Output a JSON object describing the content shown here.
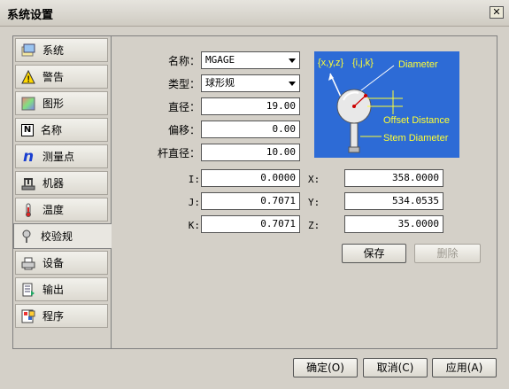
{
  "window": {
    "title": "系统设置",
    "close_glyph": "✕"
  },
  "sidebar": {
    "items": [
      {
        "label": "系统",
        "icon": "settings-icon"
      },
      {
        "label": "警告",
        "icon": "warning-icon"
      },
      {
        "label": "图形",
        "icon": "graphics-icon"
      },
      {
        "label": "名称",
        "icon": "name-icon",
        "glyph": "N"
      },
      {
        "label": "测量点",
        "icon": "measure-point-icon",
        "glyph": "n"
      },
      {
        "label": "机器",
        "icon": "machine-icon"
      },
      {
        "label": "温度",
        "icon": "thermometer-icon"
      },
      {
        "label": "校验规",
        "icon": "probe-icon"
      },
      {
        "label": "设备",
        "icon": "device-icon"
      },
      {
        "label": "输出",
        "icon": "output-icon"
      },
      {
        "label": "程序",
        "icon": "program-icon"
      }
    ],
    "active_index": 7
  },
  "form": {
    "name_label": "名称：",
    "name_value": "MGAGE",
    "type_label": "类型：",
    "type_value": "球形规",
    "diameter_label": "直径：",
    "diameter_value": "19.00",
    "offset_label": "偏移：",
    "offset_value": "0.00",
    "stem_label": "杆直径：",
    "stem_value": "10.00",
    "i_label": "I:",
    "i_value": "0.0000",
    "j_label": "J:",
    "j_value": "0.7071",
    "k_label": "K:",
    "k_value": "0.7071",
    "x_label": "X:",
    "x_value": "358.0000",
    "y_label": "Y:",
    "y_value": "534.0535",
    "z_label": "Z:",
    "z_value": "35.0000"
  },
  "diagram": {
    "xyz_text": "{x,y,z}",
    "ijk_text": "{i,j,k}",
    "diameter_text": "Diameter",
    "offset_text": "Offset Distance",
    "stem_text": "Stem Diameter",
    "bg_color": "#2d6bd6",
    "label_color": "#ffff33"
  },
  "buttons": {
    "save": "保存",
    "delete": "删除",
    "ok": "确定(O)",
    "cancel": "取消(C)",
    "apply": "应用(A)"
  }
}
